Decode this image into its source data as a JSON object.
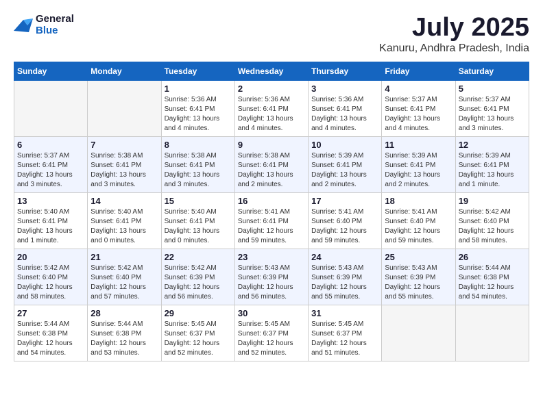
{
  "header": {
    "logo_line1": "General",
    "logo_line2": "Blue",
    "title": "July 2025",
    "subtitle": "Kanuru, Andhra Pradesh, India"
  },
  "calendar": {
    "days_of_week": [
      "Sunday",
      "Monday",
      "Tuesday",
      "Wednesday",
      "Thursday",
      "Friday",
      "Saturday"
    ],
    "weeks": [
      [
        {
          "day": "",
          "empty": true
        },
        {
          "day": "",
          "empty": true
        },
        {
          "day": "1",
          "sunrise": "Sunrise: 5:36 AM",
          "sunset": "Sunset: 6:41 PM",
          "daylight": "Daylight: 13 hours and 4 minutes."
        },
        {
          "day": "2",
          "sunrise": "Sunrise: 5:36 AM",
          "sunset": "Sunset: 6:41 PM",
          "daylight": "Daylight: 13 hours and 4 minutes."
        },
        {
          "day": "3",
          "sunrise": "Sunrise: 5:36 AM",
          "sunset": "Sunset: 6:41 PM",
          "daylight": "Daylight: 13 hours and 4 minutes."
        },
        {
          "day": "4",
          "sunrise": "Sunrise: 5:37 AM",
          "sunset": "Sunset: 6:41 PM",
          "daylight": "Daylight: 13 hours and 4 minutes."
        },
        {
          "day": "5",
          "sunrise": "Sunrise: 5:37 AM",
          "sunset": "Sunset: 6:41 PM",
          "daylight": "Daylight: 13 hours and 3 minutes."
        }
      ],
      [
        {
          "day": "6",
          "sunrise": "Sunrise: 5:37 AM",
          "sunset": "Sunset: 6:41 PM",
          "daylight": "Daylight: 13 hours and 3 minutes."
        },
        {
          "day": "7",
          "sunrise": "Sunrise: 5:38 AM",
          "sunset": "Sunset: 6:41 PM",
          "daylight": "Daylight: 13 hours and 3 minutes."
        },
        {
          "day": "8",
          "sunrise": "Sunrise: 5:38 AM",
          "sunset": "Sunset: 6:41 PM",
          "daylight": "Daylight: 13 hours and 3 minutes."
        },
        {
          "day": "9",
          "sunrise": "Sunrise: 5:38 AM",
          "sunset": "Sunset: 6:41 PM",
          "daylight": "Daylight: 13 hours and 2 minutes."
        },
        {
          "day": "10",
          "sunrise": "Sunrise: 5:39 AM",
          "sunset": "Sunset: 6:41 PM",
          "daylight": "Daylight: 13 hours and 2 minutes."
        },
        {
          "day": "11",
          "sunrise": "Sunrise: 5:39 AM",
          "sunset": "Sunset: 6:41 PM",
          "daylight": "Daylight: 13 hours and 2 minutes."
        },
        {
          "day": "12",
          "sunrise": "Sunrise: 5:39 AM",
          "sunset": "Sunset: 6:41 PM",
          "daylight": "Daylight: 13 hours and 1 minute."
        }
      ],
      [
        {
          "day": "13",
          "sunrise": "Sunrise: 5:40 AM",
          "sunset": "Sunset: 6:41 PM",
          "daylight": "Daylight: 13 hours and 1 minute."
        },
        {
          "day": "14",
          "sunrise": "Sunrise: 5:40 AM",
          "sunset": "Sunset: 6:41 PM",
          "daylight": "Daylight: 13 hours and 0 minutes."
        },
        {
          "day": "15",
          "sunrise": "Sunrise: 5:40 AM",
          "sunset": "Sunset: 6:41 PM",
          "daylight": "Daylight: 13 hours and 0 minutes."
        },
        {
          "day": "16",
          "sunrise": "Sunrise: 5:41 AM",
          "sunset": "Sunset: 6:41 PM",
          "daylight": "Daylight: 12 hours and 59 minutes."
        },
        {
          "day": "17",
          "sunrise": "Sunrise: 5:41 AM",
          "sunset": "Sunset: 6:40 PM",
          "daylight": "Daylight: 12 hours and 59 minutes."
        },
        {
          "day": "18",
          "sunrise": "Sunrise: 5:41 AM",
          "sunset": "Sunset: 6:40 PM",
          "daylight": "Daylight: 12 hours and 59 minutes."
        },
        {
          "day": "19",
          "sunrise": "Sunrise: 5:42 AM",
          "sunset": "Sunset: 6:40 PM",
          "daylight": "Daylight: 12 hours and 58 minutes."
        }
      ],
      [
        {
          "day": "20",
          "sunrise": "Sunrise: 5:42 AM",
          "sunset": "Sunset: 6:40 PM",
          "daylight": "Daylight: 12 hours and 58 minutes."
        },
        {
          "day": "21",
          "sunrise": "Sunrise: 5:42 AM",
          "sunset": "Sunset: 6:40 PM",
          "daylight": "Daylight: 12 hours and 57 minutes."
        },
        {
          "day": "22",
          "sunrise": "Sunrise: 5:42 AM",
          "sunset": "Sunset: 6:39 PM",
          "daylight": "Daylight: 12 hours and 56 minutes."
        },
        {
          "day": "23",
          "sunrise": "Sunrise: 5:43 AM",
          "sunset": "Sunset: 6:39 PM",
          "daylight": "Daylight: 12 hours and 56 minutes."
        },
        {
          "day": "24",
          "sunrise": "Sunrise: 5:43 AM",
          "sunset": "Sunset: 6:39 PM",
          "daylight": "Daylight: 12 hours and 55 minutes."
        },
        {
          "day": "25",
          "sunrise": "Sunrise: 5:43 AM",
          "sunset": "Sunset: 6:39 PM",
          "daylight": "Daylight: 12 hours and 55 minutes."
        },
        {
          "day": "26",
          "sunrise": "Sunrise: 5:44 AM",
          "sunset": "Sunset: 6:38 PM",
          "daylight": "Daylight: 12 hours and 54 minutes."
        }
      ],
      [
        {
          "day": "27",
          "sunrise": "Sunrise: 5:44 AM",
          "sunset": "Sunset: 6:38 PM",
          "daylight": "Daylight: 12 hours and 54 minutes."
        },
        {
          "day": "28",
          "sunrise": "Sunrise: 5:44 AM",
          "sunset": "Sunset: 6:38 PM",
          "daylight": "Daylight: 12 hours and 53 minutes."
        },
        {
          "day": "29",
          "sunrise": "Sunrise: 5:45 AM",
          "sunset": "Sunset: 6:37 PM",
          "daylight": "Daylight: 12 hours and 52 minutes."
        },
        {
          "day": "30",
          "sunrise": "Sunrise: 5:45 AM",
          "sunset": "Sunset: 6:37 PM",
          "daylight": "Daylight: 12 hours and 52 minutes."
        },
        {
          "day": "31",
          "sunrise": "Sunrise: 5:45 AM",
          "sunset": "Sunset: 6:37 PM",
          "daylight": "Daylight: 12 hours and 51 minutes."
        },
        {
          "day": "",
          "empty": true
        },
        {
          "day": "",
          "empty": true
        }
      ]
    ]
  }
}
